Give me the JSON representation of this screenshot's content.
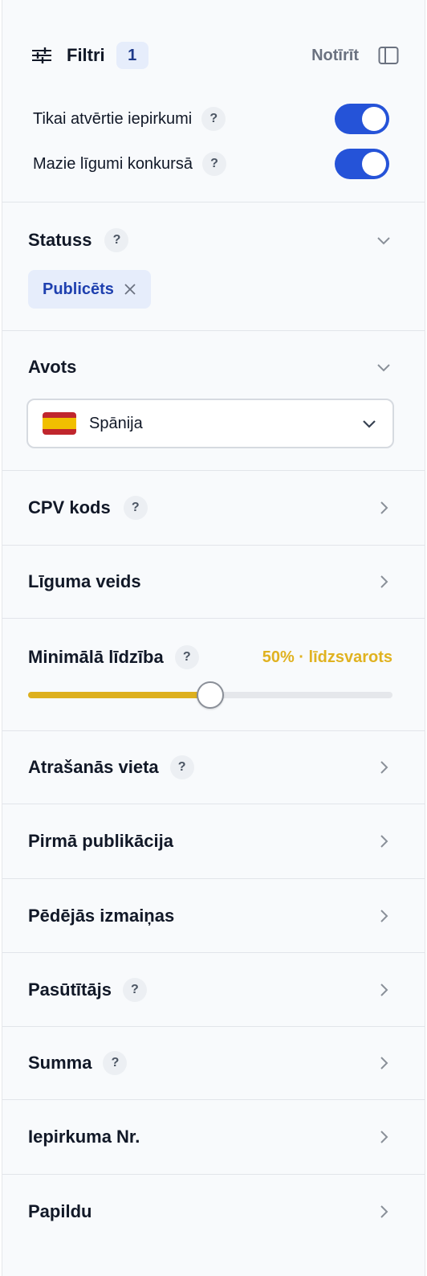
{
  "header": {
    "title": "Filtri",
    "count": "1",
    "clear_label": "Notīrīt",
    "icons": {
      "filter": "sliders-icon",
      "sidebar": "sidebar-toggle-icon"
    }
  },
  "toggles": [
    {
      "label": "Tikai atvērtie iepirkumi",
      "help": "?",
      "on": true
    },
    {
      "label": "Mazie līgumi konkursā",
      "help": "?",
      "on": true
    }
  ],
  "status": {
    "title": "Statuss",
    "help": "?",
    "chip": "Publicēts"
  },
  "source": {
    "title": "Avots",
    "selected": "Spānija",
    "flag": "spain-flag-icon"
  },
  "cpv": {
    "title": "CPV kods",
    "help": "?"
  },
  "contract_type": {
    "title": "Līguma veids"
  },
  "similarity": {
    "title": "Minimālā līdzība",
    "help": "?",
    "value_label": "50% · līdzsvarots",
    "value": 0.5
  },
  "location": {
    "title": "Atrašanās vieta",
    "help": "?"
  },
  "first_pub": {
    "title": "Pirmā publikācija"
  },
  "last_change": {
    "title": "Pēdējās izmaiņas"
  },
  "buyer": {
    "title": "Pasūtītājs",
    "help": "?"
  },
  "amount": {
    "title": "Summa",
    "help": "?"
  },
  "proc_no": {
    "title": "Iepirkuma Nr."
  },
  "extra": {
    "title": "Papildu"
  },
  "colors": {
    "accent": "#2553d8",
    "badge_bg": "#e6edfb",
    "badge_text": "#1e3a8a",
    "similarity": "#ddb01e"
  }
}
